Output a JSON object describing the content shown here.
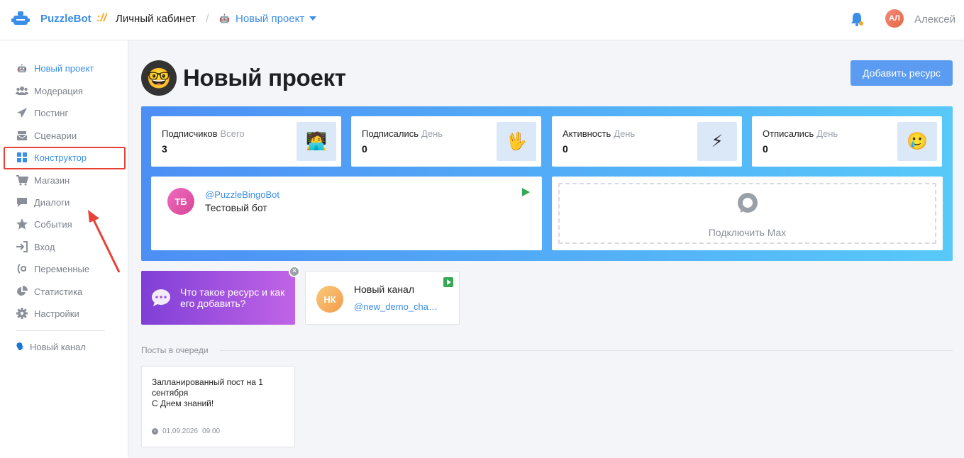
{
  "header": {
    "brand": "PuzzleBot",
    "brand_sep": "://",
    "cabinet": "Личный кабинет",
    "slash": "/",
    "project_icon": "🤖",
    "project": "Новый проект",
    "user_initials": "АЛ",
    "user_name": "Алексей"
  },
  "sidebar": {
    "items": [
      {
        "label": "Новый проект",
        "icon": "bot-icon"
      },
      {
        "label": "Модерация",
        "icon": "users-icon"
      },
      {
        "label": "Постинг",
        "icon": "paper-plane-icon"
      },
      {
        "label": "Сценарии",
        "icon": "mail-stack-icon"
      },
      {
        "label": "Конструктор",
        "icon": "grid-icon"
      },
      {
        "label": "Магазин",
        "icon": "cart-icon"
      },
      {
        "label": "Диалоги",
        "icon": "chat-icon"
      },
      {
        "label": "События",
        "icon": "star-icon"
      },
      {
        "label": "Вход",
        "icon": "sign-in-icon"
      },
      {
        "label": "Переменные",
        "icon": "at-icon"
      },
      {
        "label": "Статистика",
        "icon": "pie-chart-icon"
      },
      {
        "label": "Настройки",
        "icon": "gear-icon"
      }
    ],
    "channel": "Новый канал",
    "channel_icon": "megaphone-icon",
    "active_color": "#3b8ee8",
    "highlight_color": "#e94236"
  },
  "main": {
    "emoji": "🤓",
    "title": "Новый проект",
    "add_button": "Добавить ресурс",
    "stats": [
      {
        "label": "Подписчиков",
        "sub": "Всего",
        "value": "3",
        "emoji": "🧑‍💻"
      },
      {
        "label": "Подписались",
        "sub": "День",
        "value": "0",
        "emoji": "🖖"
      },
      {
        "label": "Активность",
        "sub": "День",
        "value": "0",
        "emoji": "⚡"
      },
      {
        "label": "Отписались",
        "sub": "День",
        "value": "0",
        "emoji": "🥲"
      }
    ],
    "bot": {
      "initials": "ТБ",
      "handle": "@PuzzleBingoBot",
      "name": "Тестовый бот"
    },
    "connect": {
      "label": "Подключить Max"
    },
    "promo": {
      "text": "Что такое ресурс и как его добавить?",
      "close": "×"
    },
    "channel": {
      "initials": "НК",
      "name": "Новый канал",
      "handle": "@new_demo_channel"
    },
    "queue_label": "Посты в очереди",
    "post": {
      "line1": "Запланированный пост на 1 сентября",
      "line2": "С Днем знаний!",
      "date": "01.09.2026",
      "time": "09:00"
    }
  }
}
